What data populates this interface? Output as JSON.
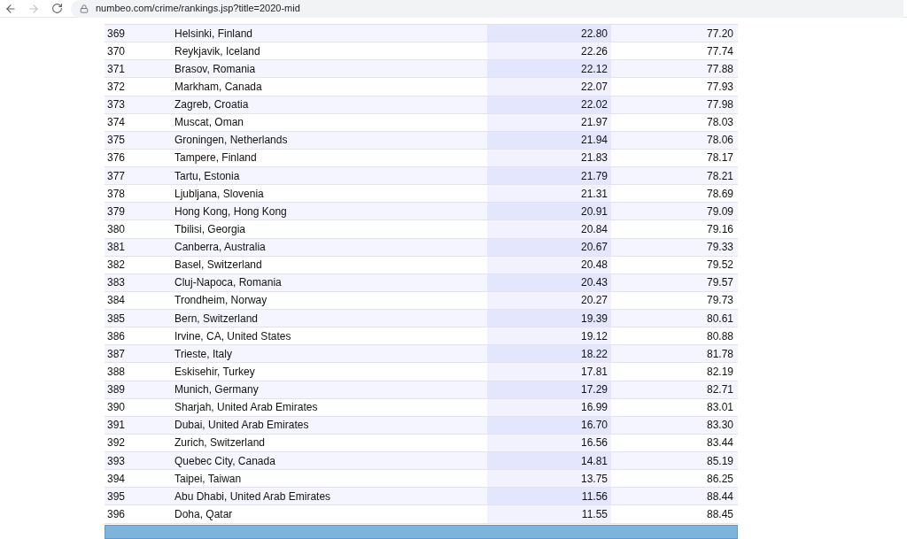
{
  "browser": {
    "back": {
      "disabled": false
    },
    "forward": {
      "disabled": true
    },
    "url": "numbeo.com/crime/rankings.jsp?title=2020-mid"
  },
  "table": {
    "rows": [
      {
        "rank": "369",
        "city": "Helsinki, Finland",
        "column_3": "22.80",
        "column_4": "77.20"
      },
      {
        "rank": "370",
        "city": "Reykjavik, Iceland",
        "column_3": "22.26",
        "column_4": "77.74"
      },
      {
        "rank": "371",
        "city": "Brasov, Romania",
        "column_3": "22.12",
        "column_4": "77.88"
      },
      {
        "rank": "372",
        "city": "Markham, Canada",
        "column_3": "22.07",
        "column_4": "77.93"
      },
      {
        "rank": "373",
        "city": "Zagreb, Croatia",
        "column_3": "22.02",
        "column_4": "77.98"
      },
      {
        "rank": "374",
        "city": "Muscat, Oman",
        "column_3": "21.97",
        "column_4": "78.03"
      },
      {
        "rank": "375",
        "city": "Groningen, Netherlands",
        "column_3": "21.94",
        "column_4": "78.06"
      },
      {
        "rank": "376",
        "city": "Tampere, Finland",
        "column_3": "21.83",
        "column_4": "78.17"
      },
      {
        "rank": "377",
        "city": "Tartu, Estonia",
        "column_3": "21.79",
        "column_4": "78.21"
      },
      {
        "rank": "378",
        "city": "Ljubljana, Slovenia",
        "column_3": "21.31",
        "column_4": "78.69"
      },
      {
        "rank": "379",
        "city": "Hong Kong, Hong Kong",
        "column_3": "20.91",
        "column_4": "79.09"
      },
      {
        "rank": "380",
        "city": "Tbilisi, Georgia",
        "column_3": "20.84",
        "column_4": "79.16"
      },
      {
        "rank": "381",
        "city": "Canberra, Australia",
        "column_3": "20.67",
        "column_4": "79.33"
      },
      {
        "rank": "382",
        "city": "Basel, Switzerland",
        "column_3": "20.48",
        "column_4": "79.52"
      },
      {
        "rank": "383",
        "city": "Cluj-Napoca, Romania",
        "column_3": "20.43",
        "column_4": "79.57"
      },
      {
        "rank": "384",
        "city": "Trondheim, Norway",
        "column_3": "20.27",
        "column_4": "79.73"
      },
      {
        "rank": "385",
        "city": "Bern, Switzerland",
        "column_3": "19.39",
        "column_4": "80.61"
      },
      {
        "rank": "386",
        "city": "Irvine, CA, United States",
        "column_3": "19.12",
        "column_4": "80.88"
      },
      {
        "rank": "387",
        "city": "Trieste, Italy",
        "column_3": "18.22",
        "column_4": "81.78"
      },
      {
        "rank": "388",
        "city": "Eskisehir, Turkey",
        "column_3": "17.81",
        "column_4": "82.19"
      },
      {
        "rank": "389",
        "city": "Munich, Germany",
        "column_3": "17.29",
        "column_4": "82.71"
      },
      {
        "rank": "390",
        "city": "Sharjah, United Arab Emirates",
        "column_3": "16.99",
        "column_4": "83.01"
      },
      {
        "rank": "391",
        "city": "Dubai, United Arab Emirates",
        "column_3": "16.70",
        "column_4": "83.30"
      },
      {
        "rank": "392",
        "city": "Zurich, Switzerland",
        "column_3": "16.56",
        "column_4": "83.44"
      },
      {
        "rank": "393",
        "city": "Quebec City, Canada",
        "column_3": "14.81",
        "column_4": "85.19"
      },
      {
        "rank": "394",
        "city": "Taipei, Taiwan",
        "column_3": "13.75",
        "column_4": "86.25"
      },
      {
        "rank": "395",
        "city": "Abu Dhabi, United Arab Emirates",
        "column_3": "11.56",
        "column_4": "88.44"
      },
      {
        "rank": "396",
        "city": "Doha, Qatar",
        "column_3": "11.55",
        "column_4": "88.45"
      }
    ]
  }
}
